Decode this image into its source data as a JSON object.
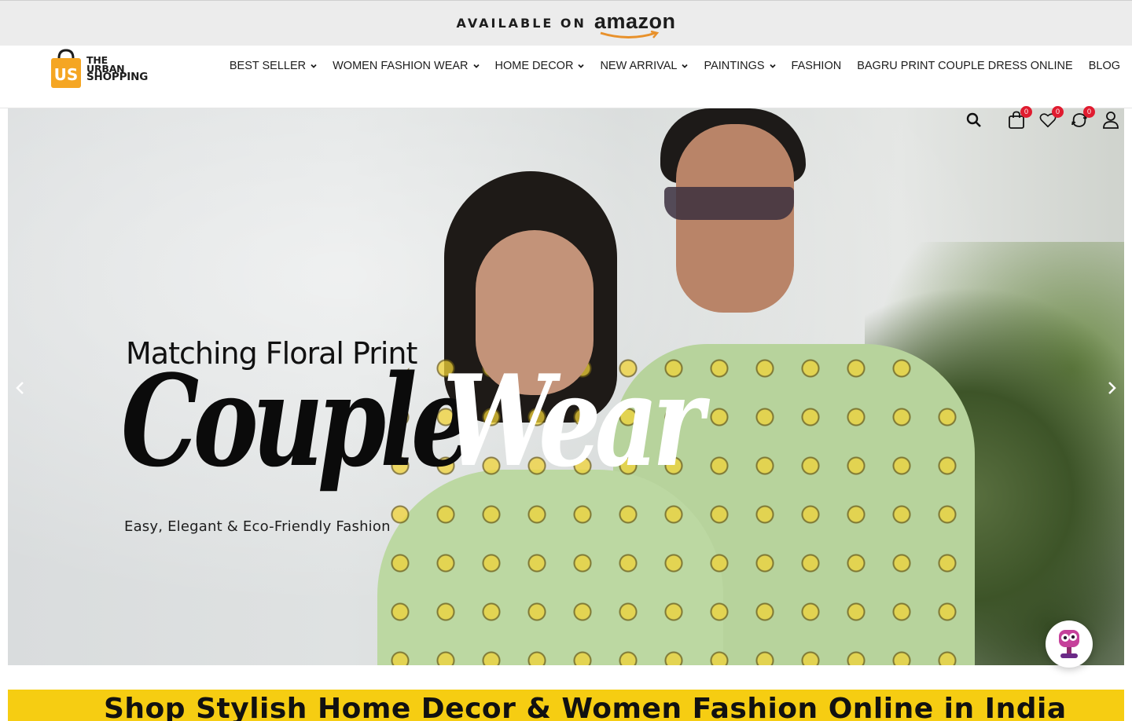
{
  "topbar": {
    "available_label": "AVAILABLE ON",
    "store_name": "amazon"
  },
  "logo": {
    "mark": "US",
    "line1": "THE",
    "line2": "URBAN",
    "line3": "SHOPPING"
  },
  "nav": {
    "items": [
      {
        "label": "BEST SELLER",
        "has_dropdown": true
      },
      {
        "label": "WOMEN FASHION WEAR",
        "has_dropdown": true
      },
      {
        "label": "HOME DECOR",
        "has_dropdown": true
      },
      {
        "label": "NEW ARRIVAL",
        "has_dropdown": true
      },
      {
        "label": "PAINTINGS",
        "has_dropdown": true
      },
      {
        "label": "FASHION",
        "has_dropdown": false
      },
      {
        "label": "BAGRU PRINT COUPLE DRESS ONLINE",
        "has_dropdown": false
      },
      {
        "label": "BLOG",
        "has_dropdown": false
      }
    ]
  },
  "header_icons": {
    "search": "search-icon",
    "cart": {
      "icon": "cart-icon",
      "count": "0"
    },
    "wishlist": {
      "icon": "heart-icon",
      "count": "0"
    },
    "compare": {
      "icon": "compare-icon",
      "count": "0"
    },
    "account": "user-icon"
  },
  "hero": {
    "tagline": "Matching Floral Print",
    "headline_dark": "Couple",
    "headline_light": "Wear",
    "subtagline": "Easy, Elegant & Eco-Friendly Fashion"
  },
  "banner": {
    "heading": "Shop Stylish Home Decor & Women Fashion Online in India"
  },
  "colors": {
    "accent_yellow": "#f6cd12",
    "badge_red": "#e01b2f",
    "logo_orange": "#f5a623",
    "topbar_bg": "#ececec"
  }
}
